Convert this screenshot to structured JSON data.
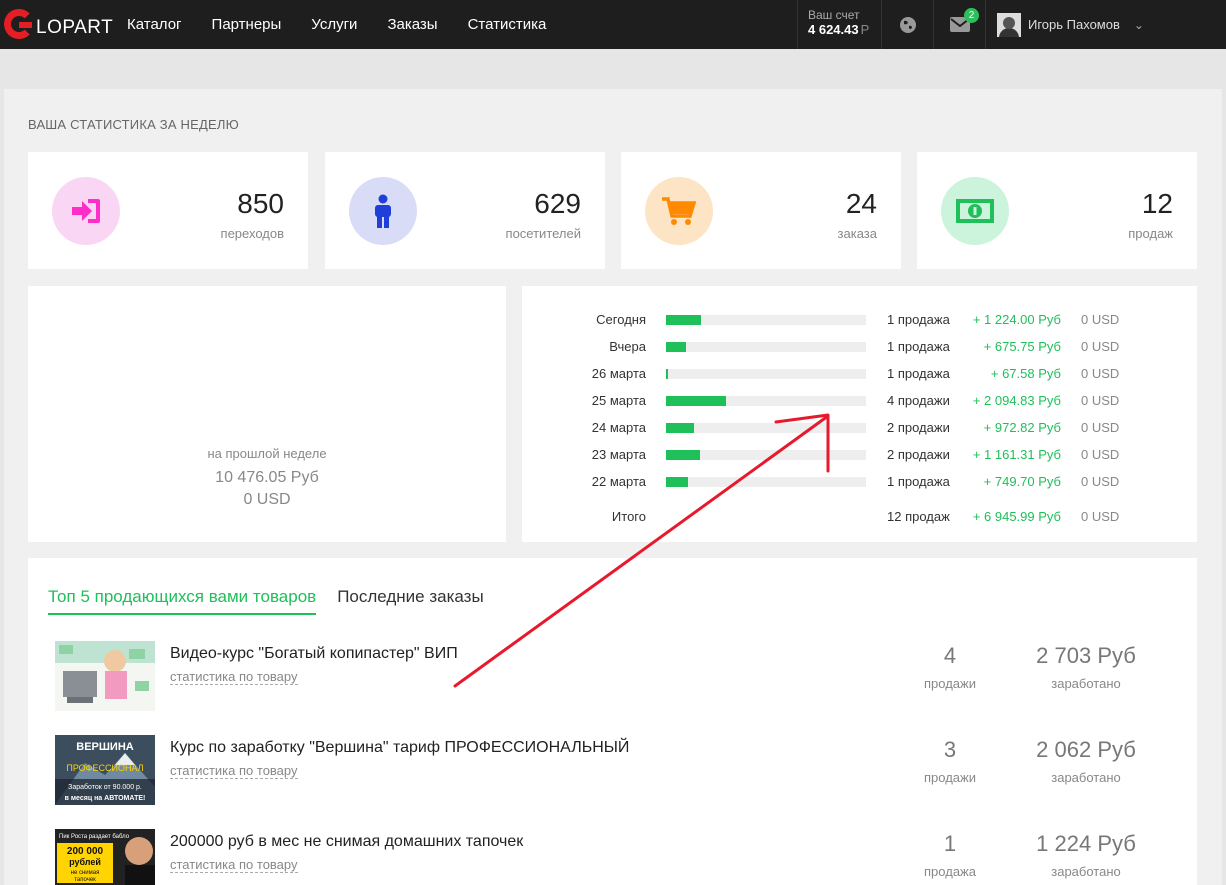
{
  "logo": {
    "text": "LOPART"
  },
  "nav": [
    "Каталог",
    "Партнеры",
    "Услуги",
    "Заказы",
    "Статистика"
  ],
  "account": {
    "label": "Ваш счет",
    "value": "4 624.43",
    "currency": "Р"
  },
  "mail_badge": "2",
  "user": {
    "name": "Игорь Пахомов"
  },
  "icons": {
    "globe": "globe-icon",
    "mail": "mail-icon",
    "chevron": "chevron-down-icon"
  },
  "section_title": "ВАША СТАТИСТИКА ЗА НЕДЕЛЮ",
  "stats": [
    {
      "value": "850",
      "label": "переходов",
      "icon": "sign-in-icon",
      "bg": "#f9d6f3",
      "fg": "#ff2ec8"
    },
    {
      "value": "629",
      "label": "посетителей",
      "icon": "person-icon",
      "bg": "#d9dcf7",
      "fg": "#1f3fd8"
    },
    {
      "value": "24",
      "label": "заказа",
      "icon": "cart-icon",
      "bg": "#fde4c4",
      "fg": "#ff8a00"
    },
    {
      "value": "12",
      "label": "продаж",
      "icon": "money-icon",
      "bg": "#ccf4dc",
      "fg": "#1fbf5a"
    }
  ],
  "last_week": {
    "label": "на прошлой неделе",
    "rub": "10 476.05 Руб",
    "usd": "0 USD"
  },
  "daily": [
    {
      "day": "Сегодня",
      "fill": 0.175,
      "count": "1 продажа",
      "rub": "+ 1 224.00 Руб",
      "usd": "0 USD"
    },
    {
      "day": "Вчера",
      "fill": 0.1,
      "count": "1 продажа",
      "rub": "+ 675.75 Руб",
      "usd": "0 USD"
    },
    {
      "day": "26 марта",
      "fill": 0.01,
      "count": "1 продажа",
      "rub": "+ 67.58 Руб",
      "usd": "0 USD"
    },
    {
      "day": "25 марта",
      "fill": 0.3,
      "count": "4 продажи",
      "rub": "+ 2 094.83 Руб",
      "usd": "0 USD"
    },
    {
      "day": "24 марта",
      "fill": 0.14,
      "count": "2 продажи",
      "rub": "+ 972.82 Руб",
      "usd": "0 USD"
    },
    {
      "day": "23 марта",
      "fill": 0.17,
      "count": "2 продажи",
      "rub": "+ 1 161.31 Руб",
      "usd": "0 USD"
    },
    {
      "day": "22 марта",
      "fill": 0.11,
      "count": "1 продажа",
      "rub": "+ 749.70 Руб",
      "usd": "0 USD"
    }
  ],
  "daily_total": {
    "day": "Итого",
    "count": "12 продаж",
    "rub": "+ 6 945.99 Руб",
    "usd": "0 USD"
  },
  "tabs": [
    "Топ 5 продающихся вами товаров",
    "Последние заказы"
  ],
  "products": [
    {
      "title": "Видео-курс \"Богатый копипастер\" ВИП",
      "link": "статистика по товару",
      "qty": "4",
      "qty_label": "продажи",
      "amount": "2 703 Руб",
      "amount_label": "заработано"
    },
    {
      "title": "Курс по заработку \"Вершина\" тариф ПРОФЕССИОНАЛЬНЫЙ",
      "link": "статистика по товару",
      "qty": "3",
      "qty_label": "продажи",
      "amount": "2 062 Руб",
      "amount_label": "заработано",
      "thumb_text": [
        "ВЕРШИНА",
        "ПРОФЕССИОНАЛ",
        "Заработок от 90.000 р.",
        "в месяц на АВТОМАТЕ!"
      ]
    },
    {
      "title": "200000 руб в мес не снимая домашних тапочек",
      "link": "статистика по товару",
      "qty": "1",
      "qty_label": "продажа",
      "amount": "1 224 Руб",
      "amount_label": "заработано",
      "thumb_text": [
        "Пик Роста раздает бабло",
        "200 000",
        "рублей",
        "не снимая",
        "тапочек"
      ]
    }
  ]
}
